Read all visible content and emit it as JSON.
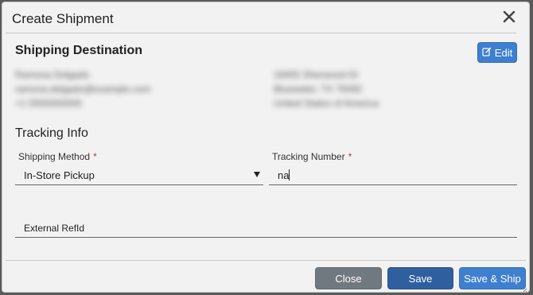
{
  "modal": {
    "title": "Create Shipment"
  },
  "destination": {
    "heading": "Shipping Destination",
    "edit_label": "Edit",
    "left_lines": [
      "Ramona Delgado",
      "ramona.delgado@example.com",
      "+1 5555555555"
    ],
    "right_lines": [
      "18455 Sherwood Dr",
      "Bluewater, TX 75092",
      "United States of America"
    ]
  },
  "tracking": {
    "heading": "Tracking Info",
    "shipping_method_label": "Shipping Method",
    "shipping_method_value": "In-Store Pickup",
    "tracking_number_label": "Tracking Number",
    "tracking_number_value": "na",
    "required_mark": "*",
    "external_ref_placeholder": "External RefId"
  },
  "footer": {
    "close_label": "Close",
    "save_label": "Save",
    "save_ship_label": "Save & Ship"
  },
  "colors": {
    "primary": "#3f7fcf",
    "primary_dark": "#2f5f9e",
    "secondary": "#707880",
    "required": "#c0392b"
  }
}
